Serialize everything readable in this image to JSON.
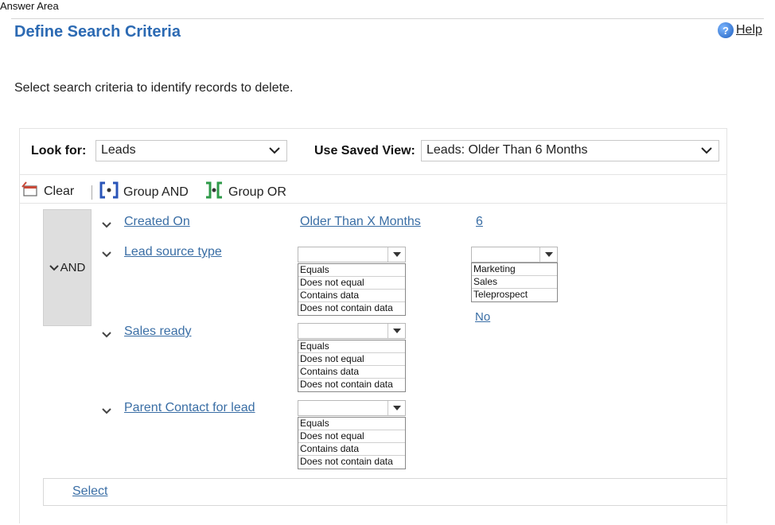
{
  "answer_area": "Answer Area",
  "header": {
    "title": "Define Search Criteria",
    "help_label": "Help",
    "help_glyph": "?"
  },
  "instruction": "Select search criteria to identify records to delete.",
  "look_for": {
    "label": "Look for:",
    "value": "Leads"
  },
  "saved_view": {
    "label": "Use Saved View:",
    "value": "Leads: Older Than 6 Months"
  },
  "toolbar": {
    "clear": "Clear",
    "group_and": "Group AND",
    "group_or": "Group OR"
  },
  "group": {
    "operator": "AND"
  },
  "rows": [
    {
      "field": "Created On",
      "operator": "Older Than X Months",
      "value": "6"
    },
    {
      "field": "Lead source type",
      "operator_options": [
        "Equals",
        "Does not equal",
        "Contains data",
        "Does not contain data"
      ],
      "value_options": [
        "Marketing",
        "Sales",
        "Teleprospect"
      ]
    },
    {
      "field": "Sales ready",
      "operator_options": [
        "Equals",
        "Does not equal",
        "Contains data",
        "Does not contain data"
      ],
      "value": "No"
    },
    {
      "field": "Parent Contact for lead",
      "operator_options": [
        "Equals",
        "Does not equal",
        "Contains data",
        "Does not contain data"
      ]
    }
  ],
  "select_link": "Select",
  "colors": {
    "title": "#2c6ab3",
    "link": "#3a6ea5",
    "and_block": "#dedede"
  }
}
